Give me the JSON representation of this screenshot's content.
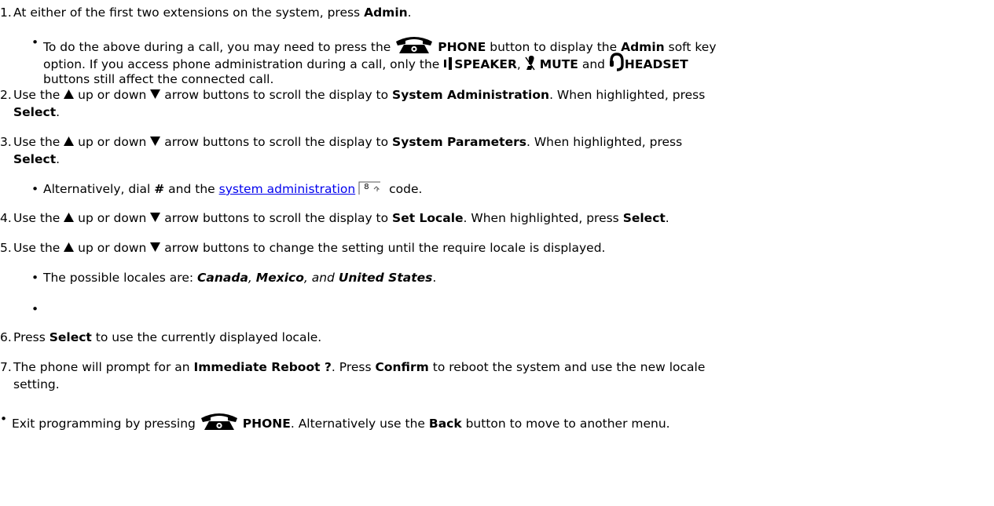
{
  "steps": [
    {
      "num": "1.",
      "parts": [
        "At either of the first two extensions on the system, press ",
        "Admin",
        "."
      ],
      "bullet": {
        "a": "To do the above during a call, you may need to press the",
        "phone": "PHONE",
        "b": " button to display the ",
        "admin": "Admin",
        "c": " soft key",
        "d": "option. If you access phone administration during a call, only the",
        "speaker": "SPEAKER",
        "comma": ", ",
        "mute": "MUTE",
        "and": " and ",
        "headset": "HEADSET",
        "e": "buttons still affect the connected call."
      }
    },
    {
      "num": "2.",
      "a": "Use the ",
      "b": " up or down ",
      "c": " arrow buttons to scroll the display to ",
      "target": "System Administration",
      "d": ". When highlighted, press",
      "select": "Select",
      "end": "."
    },
    {
      "num": "3.",
      "a": "Use the ",
      "b": " up or down ",
      "c": " arrow buttons to scroll the display to ",
      "target": "System Parameters",
      "d": ". When highlighted, press",
      "select": "Select",
      "end": ".",
      "bullet": {
        "a": "Alternatively, dial ",
        "hash": "#",
        "b": " and the ",
        "link": "system administration",
        "ref": "8",
        "c": " code."
      }
    },
    {
      "num": "4.",
      "a": "Use the ",
      "b": " up or down ",
      "c": " arrow buttons to scroll the display to ",
      "target": "Set Locale",
      "d": ". When highlighted, press ",
      "select": "Select",
      "end": "."
    },
    {
      "num": "5.",
      "a": "Use the ",
      "b": " up or down ",
      "c": " arrow buttons to change the setting until the require locale is displayed.",
      "bullet": {
        "a": "The possible locales are: ",
        "canada": "Canada",
        "comma1": ", ",
        "mexico": "Mexico",
        "comma2": ", and ",
        "us": "United States",
        "end": "."
      }
    },
    {
      "num": "6.",
      "a": "Press ",
      "select": "Select",
      "b": " to use the currently displayed locale."
    },
    {
      "num": "7.",
      "a": "The phone will prompt for an ",
      "reboot": "Immediate Reboot ?",
      "b": ". Press ",
      "confirm": "Confirm",
      "c": " to reboot the system and use the new locale",
      "d": "setting."
    }
  ],
  "exit": {
    "a": "Exit programming by pressing ",
    "phone": "PHONE",
    "b": ". Alternatively use the ",
    "back": "Back",
    "c": " button to move to another menu."
  },
  "bullet_char": "•",
  "icons": [
    "phone-icon",
    "speaker-icon",
    "mute-icon",
    "headset-icon",
    "up-arrow-icon",
    "down-arrow-icon",
    "xref-icon"
  ]
}
